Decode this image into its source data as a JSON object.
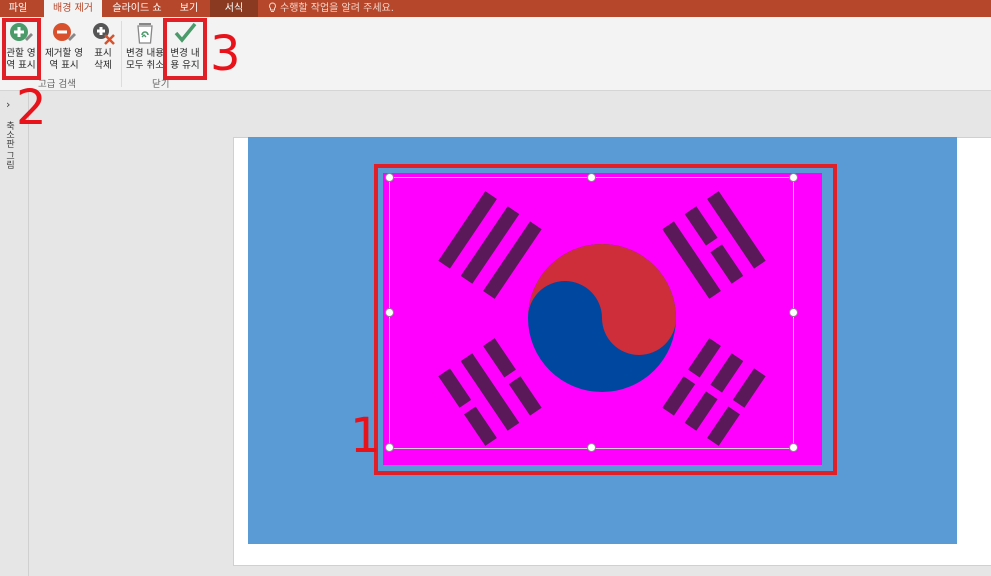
{
  "tabs": [
    {
      "label": "파일",
      "active": false
    },
    {
      "label": "배경 제거",
      "active": true
    },
    {
      "label": "슬라이드 쇼",
      "active": false
    },
    {
      "label": "보기",
      "active": false
    },
    {
      "label": "서식",
      "active": false,
      "contextual": true
    }
  ],
  "tell_me": "수행할 작업을 알려 주세요.",
  "ribbon": {
    "buttons": [
      {
        "label1": "관할 영",
        "label2": "역 표시",
        "icon": "plus-pencil-icon"
      },
      {
        "label1": "제거할 영",
        "label2": "역 표시",
        "icon": "minus-pencil-icon"
      },
      {
        "label1": "표시",
        "label2": "삭제",
        "icon": "delete-mark-icon"
      },
      {
        "label1": "변경 내용",
        "label2": "모두 취소",
        "icon": "recycle-bin-icon"
      },
      {
        "label1": "변경 내",
        "label2": "용 유지",
        "icon": "checkmark-icon"
      }
    ],
    "groups": [
      {
        "label": "고급 검색"
      },
      {
        "label": "닫기"
      }
    ]
  },
  "thumbnail_pane": {
    "label": "축소판 그림"
  },
  "annotations": [
    "1",
    "2",
    "3"
  ],
  "colors": {
    "accent": "#b7472a",
    "flag_background": "#ff00ff",
    "slide_background": "#5b9bd5",
    "annotation_red": "#e11f26"
  }
}
